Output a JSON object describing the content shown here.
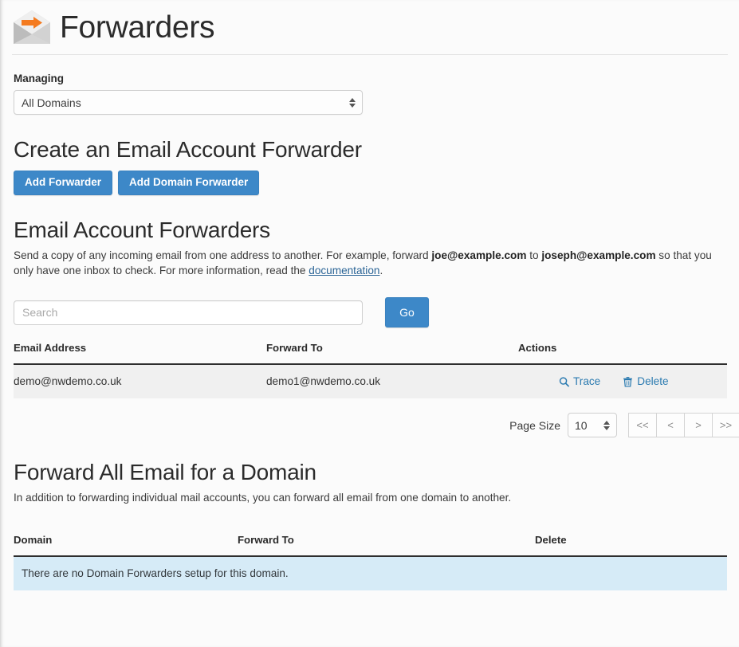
{
  "header": {
    "title": "Forwarders",
    "icon": "envelope-forward-icon"
  },
  "managing": {
    "label": "Managing",
    "selected": "All Domains"
  },
  "create_section": {
    "heading": "Create an Email Account Forwarder",
    "add_forwarder_label": "Add Forwarder",
    "add_domain_forwarder_label": "Add Domain Forwarder"
  },
  "account_forwarders": {
    "heading": "Email Account Forwarders",
    "desc_part1": "Send a copy of any incoming email from one address to another. For example, forward ",
    "desc_bold1": "joe@example.com",
    "desc_part2": " to ",
    "desc_bold2": "joseph@example.com",
    "desc_part3": " so that you only have one inbox to check. For more information, read the ",
    "desc_link": "documentation",
    "desc_part4": ".",
    "search_placeholder": "Search",
    "search_value": "",
    "go_label": "Go",
    "columns": [
      "Email Address",
      "Forward To",
      "Actions"
    ],
    "rows": [
      {
        "email": "demo@nwdemo.co.uk",
        "forward_to": "demo1@nwdemo.co.uk",
        "trace_label": "Trace",
        "delete_label": "Delete"
      }
    ],
    "pagination": {
      "page_size_label": "Page Size",
      "page_size_value": "10",
      "first_label": "<<",
      "prev_label": "<",
      "next_label": ">",
      "last_label": ">>"
    }
  },
  "domain_forwarders": {
    "heading": "Forward All Email for a Domain",
    "desc": "In addition to forwarding individual mail accounts, you can forward all email from one domain to another.",
    "columns": [
      "Domain",
      "Forward To",
      "Delete"
    ],
    "empty_message": "There are no Domain Forwarders setup for this domain."
  },
  "colors": {
    "primary_blue": "#3d88c8",
    "link_blue": "#2a7ab0",
    "info_bg": "#d6ebf7",
    "accent_orange": "#f47b20"
  }
}
